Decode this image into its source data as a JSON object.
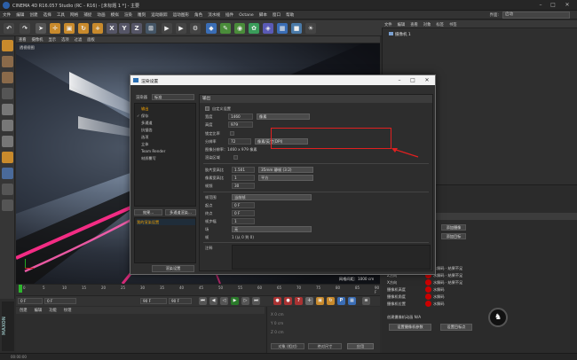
{
  "app": {
    "title": "CINEMA 4D R16.057 Studio (RC - R16) - [未标题 1 *] - 主要",
    "layout_label": "界面:",
    "layout_value": "启动"
  },
  "menubar": [
    "文件",
    "编辑",
    "创建",
    "选择",
    "工具",
    "网格",
    "捕捉",
    "动画",
    "模拟",
    "渲染",
    "雕刻",
    "运动跟踪",
    "运动图形",
    "角色",
    "流水线",
    "插件",
    "Octane",
    "脚本",
    "窗口",
    "帮助"
  ],
  "viewport": {
    "menu": [
      "查看",
      "摄像机",
      "显示",
      "选项",
      "过滤",
      "面板"
    ],
    "camera_tag": "透视视图",
    "grid_info": "网格间距：1000 cm"
  },
  "timeline": {
    "ticks": [
      "0",
      "5",
      "10",
      "15",
      "20",
      "25",
      "30",
      "35",
      "40",
      "45",
      "50",
      "55",
      "60",
      "65",
      "70",
      "75",
      "80",
      "85",
      "90 F"
    ],
    "start": "0 F",
    "current": "0 F",
    "end": "90 F",
    "end2": "90 F"
  },
  "materials": {
    "menu": [
      "创建",
      "编辑",
      "功能",
      "纹理"
    ]
  },
  "statusbar": "00:00:00",
  "objects": {
    "menu": [
      "文件",
      "编辑",
      "查看",
      "对象",
      "标签",
      "书签"
    ],
    "row": "摄像机 1"
  },
  "dialog": {
    "title": "渲染设置",
    "renderer_label": "渲染器",
    "renderer_value": "标准",
    "left_items": [
      {
        "label": "输出",
        "checked": "",
        "selected": true
      },
      {
        "label": "保存",
        "checked": "✓",
        "selected": false
      },
      {
        "label": "多通道",
        "checked": "",
        "selected": false
      },
      {
        "label": "抗锯齿",
        "checked": "",
        "selected": false
      },
      {
        "label": "选项",
        "checked": "",
        "selected": false
      },
      {
        "label": "立体",
        "checked": "",
        "selected": false
      },
      {
        "label": "Team Render",
        "checked": "",
        "selected": false
      },
      {
        "label": "材质覆写",
        "checked": "",
        "selected": false
      }
    ],
    "effects_button": "效果...",
    "multipass_button": "多通道渲染...",
    "current_setting": "我的渲染设置",
    "save_button": "渲染设置",
    "output_header": "输出",
    "preset_label": "自定义设置",
    "width_label": "宽度",
    "width_value": "1460",
    "width_unit": "像素",
    "height_label": "高度",
    "height_value": "979",
    "lock_ratio": "锁定比率",
    "resolution_label": "分辨率",
    "resolution_value": "72",
    "resolution_unit": "像素/英寸(DPI)",
    "image_res_label": "图像分辨率：1460 x 979 像素",
    "render_region": "渲染区域",
    "film_ratio_label": "胶片宽高比",
    "film_ratio_value": "1.501",
    "film_ratio_preset": "35mm 静帧 (3:2)",
    "pixel_ratio_label": "像素宽高比",
    "pixel_ratio_value": "1",
    "pixel_ratio_preset": "平方",
    "fps_label": "帧频",
    "fps_value": "30",
    "frame_range_label": "帧范围",
    "frame_range_value": "当前帧",
    "start_label": "起点",
    "start_value": "0 F",
    "end_label": "终点",
    "end_value": "0 F",
    "step_label": "帧步幅",
    "step_value": "1",
    "field_label": "场",
    "field_value": "无",
    "frames_label": "帧",
    "frames_value": "1 (从 0 到 0)",
    "notes_label": "注释"
  },
  "attributes": {
    "rows": [
      {
        "label": "V方向",
        "value": "水解码 · 结果不足"
      },
      {
        "label": "Z方向",
        "value": "水解码 · 结果不足"
      },
      {
        "label": "X方向",
        "value": "水解码 · 结果不足"
      },
      {
        "label": "摄像机高度",
        "value": "水解码"
      },
      {
        "label": "摄像机角度",
        "value": "水解码"
      },
      {
        "label": "摄像机位置",
        "value": "水解码"
      }
    ],
    "footnote": "创建摄像机动画 N/A",
    "btn_left": "设置摄像机参数",
    "btn_right": "设置目标点",
    "side_btn1": "添加摄像",
    "side_btn2": "添加目标"
  },
  "coords": {
    "apply": "应用",
    "mode1": "对象 (相对)",
    "mode2": "绝对尺寸"
  },
  "colors": {
    "accent": "#f0a000",
    "highlight": "#e02020",
    "neon": "#ff2d8a"
  }
}
